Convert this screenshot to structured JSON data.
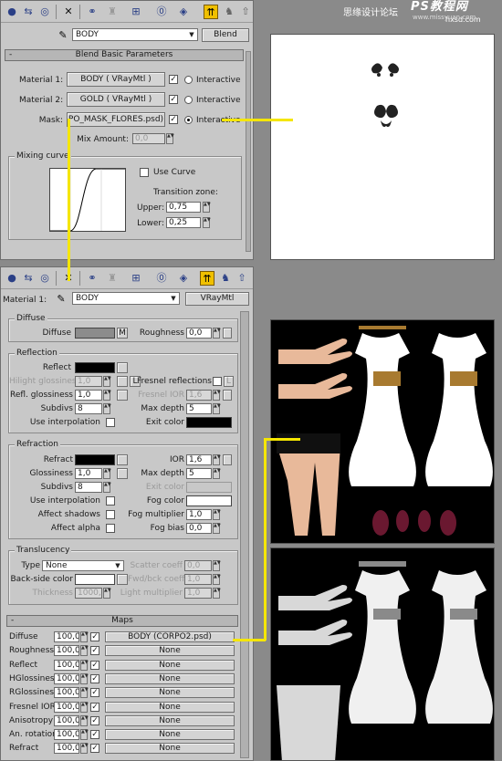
{
  "header": {
    "cn_text": "思缘设计论坛",
    "site": "www.missyuan.com",
    "logo": "PS教程网",
    "logo_sub": "hxsd.com"
  },
  "top_panel": {
    "material_name": "BODY",
    "type_button": "Blend",
    "rollout_title": "Blend Basic Parameters",
    "material1_label": "Material 1:",
    "material1_value": "BODY  ( VRayMtl )",
    "material2_label": "Material 2:",
    "material2_value": "GOLD  ( VRayMtl )",
    "mask_label": "Mask:",
    "mask_value": "PO_MASK_FLORES.psd)",
    "interactive_label": "Interactive",
    "mix_amount_label": "Mix Amount:",
    "mix_amount_value": "0,0",
    "mixing_curve_label": "Mixing curve",
    "use_curve_label": "Use Curve",
    "transition_zone_label": "Transition zone:",
    "upper_label": "Upper:",
    "upper_value": "0,75",
    "lower_label": "Lower:",
    "lower_value": "0,25"
  },
  "bottom_panel": {
    "material_label": "Material 1:",
    "material_name": "BODY",
    "type_button": "VRayMtl",
    "diffuse": {
      "group": "Diffuse",
      "diffuse_label": "Diffuse",
      "m_button": "M",
      "roughness_label": "Roughness",
      "roughness_value": "0,0",
      "color": "#8c8c8c"
    },
    "reflection": {
      "group": "Reflection",
      "reflect_label": "Reflect",
      "hilight_label": "Hilight glossiness",
      "hilight_value": "1,0",
      "l_button": "L",
      "fresnel_label": "Fresnel reflections",
      "fresnel_l": "L",
      "refl_gloss_label": "Refl. glossiness",
      "refl_gloss_value": "1,0",
      "fresnel_ior_label": "Fresnel IOR",
      "fresnel_ior_value": "1,6",
      "subdivs_label": "Subdivs",
      "subdivs_value": "8",
      "max_depth_label": "Max depth",
      "max_depth_value": "5",
      "use_interp_label": "Use interpolation",
      "exit_color_label": "Exit color",
      "reflect_color": "#000000",
      "exit_color": "#000000"
    },
    "refraction": {
      "group": "Refraction",
      "refract_label": "Refract",
      "ior_label": "IOR",
      "ior_value": "1,6",
      "glossiness_label": "Glossiness",
      "glossiness_value": "1,0",
      "max_depth_label": "Max depth",
      "max_depth_value": "5",
      "subdivs_label": "Subdivs",
      "subdivs_value": "8",
      "exit_color_label": "Exit color",
      "use_interp_label": "Use interpolation",
      "fog_color_label": "Fog color",
      "affect_shadows_label": "Affect shadows",
      "fog_mult_label": "Fog multiplier",
      "fog_mult_value": "1,0",
      "affect_alpha_label": "Affect alpha",
      "fog_bias_label": "Fog bias",
      "fog_bias_value": "0,0",
      "refract_color": "#000000",
      "fog_color": "#ffffff"
    },
    "translucency": {
      "group": "Translucency",
      "type_label": "Type",
      "type_value": "None",
      "scatter_label": "Scatter coeff",
      "scatter_value": "0,0",
      "backside_label": "Back-side color",
      "fwdbck_label": "Fwd/bck coeff",
      "fwdbck_value": "1,0",
      "thickness_label": "Thickness",
      "thickness_value": "1000,0",
      "light_mult_label": "Light multiplier",
      "light_mult_value": "1,0"
    },
    "maps": {
      "title": "Maps",
      "rows": [
        {
          "label": "Diffuse",
          "amount": "100,0",
          "map": "BODY (CORPO2.psd)"
        },
        {
          "label": "Roughness",
          "amount": "100,0",
          "map": "None"
        },
        {
          "label": "Reflect",
          "amount": "100,0",
          "map": "None"
        },
        {
          "label": "HGlossiness",
          "amount": "100,0",
          "map": "None"
        },
        {
          "label": "RGlossiness",
          "amount": "100,0",
          "map": "None"
        },
        {
          "label": "Fresnel IOR",
          "amount": "100,0",
          "map": "None"
        },
        {
          "label": "Anisotropy",
          "amount": "100,0",
          "map": "None"
        },
        {
          "label": "An. rotation",
          "amount": "100,0",
          "map": "None"
        },
        {
          "label": "Refract",
          "amount": "100,0",
          "map": "None"
        }
      ]
    }
  },
  "colors": {
    "accent": "#f5e600",
    "panel": "#c8c8c8",
    "background": "#8a8a8a"
  }
}
